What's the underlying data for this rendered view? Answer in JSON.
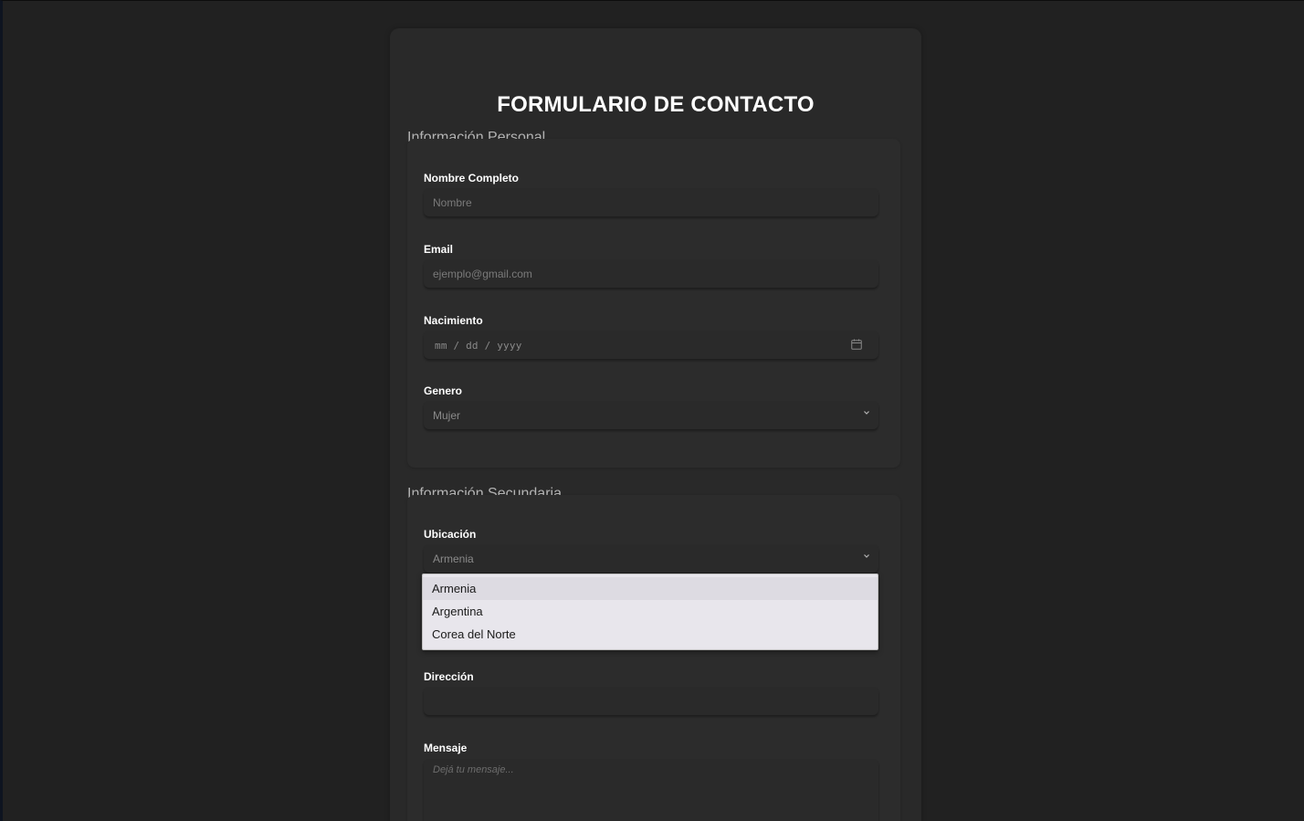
{
  "form": {
    "title": "FORMULARIO DE CONTACTO",
    "sections": {
      "personal": {
        "legend": "Información Personal",
        "name": {
          "label": "Nombre Completo",
          "placeholder": "Nombre"
        },
        "email": {
          "label": "Email",
          "placeholder": "ejemplo@gmail.com"
        },
        "birth": {
          "label": "Nacimiento",
          "placeholder": "mm / dd / yyyy",
          "icon": "calendar-icon"
        },
        "gender": {
          "label": "Genero",
          "value": "Mujer",
          "icon": "chevron-down-icon"
        }
      },
      "secondary": {
        "legend": "Información Secundaria",
        "location": {
          "label": "Ubicación",
          "value": "Armenia",
          "icon": "chevron-down-icon",
          "options": [
            "Armenia",
            "Argentina",
            "Corea del Norte"
          ]
        },
        "address": {
          "label": "Dirección",
          "value": ""
        },
        "message": {
          "label": "Mensaje",
          "placeholder": "Dejá tu mensaje..."
        }
      }
    }
  },
  "colors": {
    "background": "#212121",
    "card": "#292929",
    "dropdown_bg": "#e8e6ec",
    "dropdown_selected": "#dddbe2"
  }
}
